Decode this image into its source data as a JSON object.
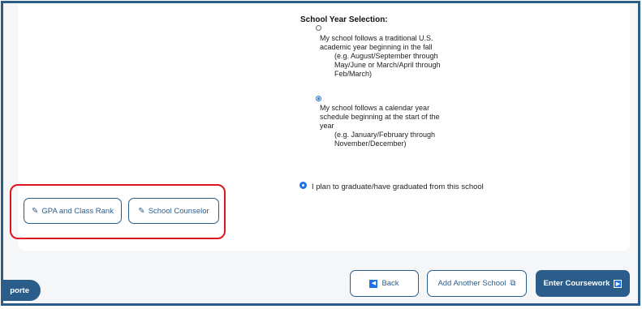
{
  "school_year": {
    "title": "School Year Selection:",
    "option1": {
      "text_lines": [
        "My school follows a traditional U.S.",
        "academic year beginning in the fall"
      ],
      "example_lines": [
        "(e.g. August/September through",
        "May/June or March/April through",
        "Feb/March)"
      ],
      "selected": false
    },
    "option2": {
      "text_lines": [
        "My school follows a calendar year",
        "schedule beginning at the start of the",
        "year"
      ],
      "example_lines": [
        "(e.g. January/February through",
        "November/December)"
      ],
      "selected": true
    }
  },
  "graduate": {
    "label": "I plan to graduate/have graduated from this school",
    "selected": true
  },
  "side_buttons": {
    "gpa": "GPA and Class Rank",
    "counselor": "School Counselor"
  },
  "footer": {
    "back": "Back",
    "add_school": "Add Another School",
    "enter_coursework": "Enter Coursework",
    "report": "porte"
  },
  "colors": {
    "primary": "#2b5d8a",
    "radio_accent": "#1a73e8",
    "highlight": "#e0141e"
  },
  "icons": {
    "edit": "edit-icon",
    "external": "external-link-icon",
    "prev": "chevron-left-icon",
    "next": "chevron-right-icon"
  }
}
